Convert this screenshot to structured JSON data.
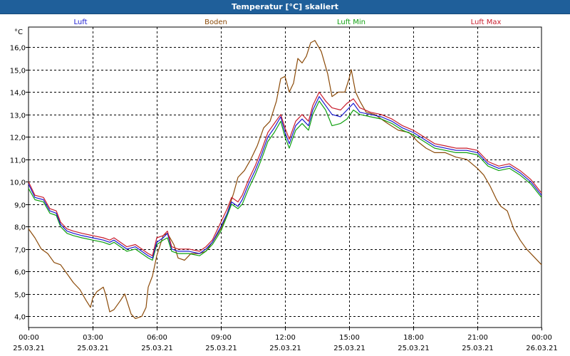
{
  "window": {
    "title": "Temperatur [°C] skaliert"
  },
  "chart_data": {
    "type": "line",
    "title": "Temperatur [°C] skaliert",
    "ylabel": "°C",
    "xlabel": "",
    "ylim": [
      3.5,
      16.9
    ],
    "yticks": [
      4.0,
      5.0,
      6.0,
      7.0,
      8.0,
      9.0,
      10.0,
      11.0,
      12.0,
      13.0,
      14.0,
      15.0,
      16.0
    ],
    "ytick_labels": [
      "4,0",
      "5,0",
      "6,0",
      "7,0",
      "8,0",
      "9,0",
      "10,0",
      "11,0",
      "12,0",
      "13,0",
      "14,0",
      "15,0",
      "16,0"
    ],
    "xlim_hours": [
      0,
      24
    ],
    "xticks": [
      {
        "hour": 0,
        "time": "00:00",
        "date": "25.03.21"
      },
      {
        "hour": 3,
        "time": "03:00",
        "date": "25.03.21"
      },
      {
        "hour": 6,
        "time": "06:00",
        "date": "25.03.21"
      },
      {
        "hour": 9,
        "time": "09:00",
        "date": "25.03.21"
      },
      {
        "hour": 12,
        "time": "12:00",
        "date": "25.03.21"
      },
      {
        "hour": 15,
        "time": "15:00",
        "date": "25.03.21"
      },
      {
        "hour": 18,
        "time": "18:00",
        "date": "25.03.21"
      },
      {
        "hour": 21,
        "time": "21:00",
        "date": "25.03.21"
      },
      {
        "hour": 24,
        "time": "00:00",
        "date": "26.03.21"
      }
    ],
    "grid": true,
    "legend_position": "top",
    "series": [
      {
        "name": "Luft",
        "color": "#1a1ad0",
        "points": [
          [
            0,
            9.9
          ],
          [
            0.3,
            9.3
          ],
          [
            0.7,
            9.2
          ],
          [
            1.0,
            8.7
          ],
          [
            1.3,
            8.6
          ],
          [
            1.5,
            8.1
          ],
          [
            1.8,
            7.8
          ],
          [
            2.1,
            7.7
          ],
          [
            2.5,
            7.6
          ],
          [
            3.0,
            7.5
          ],
          [
            3.5,
            7.4
          ],
          [
            3.8,
            7.3
          ],
          [
            4.0,
            7.4
          ],
          [
            4.3,
            7.2
          ],
          [
            4.6,
            7.0
          ],
          [
            5.0,
            7.1
          ],
          [
            5.3,
            6.9
          ],
          [
            5.6,
            6.7
          ],
          [
            5.8,
            6.6
          ],
          [
            6.0,
            7.3
          ],
          [
            6.3,
            7.5
          ],
          [
            6.5,
            7.7
          ],
          [
            6.7,
            7.0
          ],
          [
            7.0,
            6.9
          ],
          [
            7.5,
            6.9
          ],
          [
            8.0,
            6.8
          ],
          [
            8.3,
            7.0
          ],
          [
            8.6,
            7.3
          ],
          [
            9.0,
            8.0
          ],
          [
            9.3,
            8.6
          ],
          [
            9.5,
            9.1
          ],
          [
            9.8,
            8.9
          ],
          [
            10.0,
            9.2
          ],
          [
            10.3,
            9.9
          ],
          [
            10.6,
            10.5
          ],
          [
            10.9,
            11.2
          ],
          [
            11.2,
            12.0
          ],
          [
            11.5,
            12.4
          ],
          [
            11.8,
            12.9
          ],
          [
            12.0,
            12.2
          ],
          [
            12.2,
            11.7
          ],
          [
            12.5,
            12.5
          ],
          [
            12.8,
            12.8
          ],
          [
            13.1,
            12.5
          ],
          [
            13.3,
            13.2
          ],
          [
            13.6,
            13.8
          ],
          [
            13.9,
            13.4
          ],
          [
            14.2,
            13.0
          ],
          [
            14.6,
            12.9
          ],
          [
            14.9,
            13.2
          ],
          [
            15.2,
            13.5
          ],
          [
            15.5,
            13.1
          ],
          [
            16.0,
            13.0
          ],
          [
            16.5,
            12.9
          ],
          [
            17.0,
            12.7
          ],
          [
            17.5,
            12.4
          ],
          [
            18.0,
            12.2
          ],
          [
            18.5,
            11.9
          ],
          [
            19.0,
            11.6
          ],
          [
            19.5,
            11.5
          ],
          [
            20.0,
            11.4
          ],
          [
            20.5,
            11.4
          ],
          [
            21.0,
            11.3
          ],
          [
            21.5,
            10.8
          ],
          [
            22.0,
            10.6
          ],
          [
            22.5,
            10.7
          ],
          [
            23.0,
            10.4
          ],
          [
            23.5,
            10.0
          ],
          [
            24.0,
            9.4
          ]
        ]
      },
      {
        "name": "Boden",
        "color": "#8b4a08",
        "points": [
          [
            0,
            7.9
          ],
          [
            0.3,
            7.5
          ],
          [
            0.6,
            7.0
          ],
          [
            0.9,
            6.8
          ],
          [
            1.2,
            6.4
          ],
          [
            1.5,
            6.3
          ],
          [
            1.8,
            5.9
          ],
          [
            2.1,
            5.5
          ],
          [
            2.4,
            5.2
          ],
          [
            2.7,
            4.7
          ],
          [
            2.9,
            4.4
          ],
          [
            3.0,
            4.8
          ],
          [
            3.2,
            5.1
          ],
          [
            3.5,
            5.3
          ],
          [
            3.6,
            5.0
          ],
          [
            3.8,
            4.2
          ],
          [
            4.0,
            4.3
          ],
          [
            4.3,
            4.7
          ],
          [
            4.5,
            5.0
          ],
          [
            4.8,
            4.1
          ],
          [
            5.0,
            3.9
          ],
          [
            5.3,
            4.0
          ],
          [
            5.5,
            4.4
          ],
          [
            5.6,
            5.3
          ],
          [
            5.8,
            5.8
          ],
          [
            6.0,
            6.7
          ],
          [
            6.3,
            7.6
          ],
          [
            6.5,
            7.7
          ],
          [
            6.8,
            7.2
          ],
          [
            7.0,
            6.6
          ],
          [
            7.3,
            6.5
          ],
          [
            7.6,
            6.8
          ],
          [
            8.0,
            6.8
          ],
          [
            8.3,
            6.9
          ],
          [
            8.6,
            7.3
          ],
          [
            9.0,
            7.9
          ],
          [
            9.3,
            8.6
          ],
          [
            9.6,
            9.5
          ],
          [
            9.8,
            10.2
          ],
          [
            10.1,
            10.5
          ],
          [
            10.4,
            11.0
          ],
          [
            10.7,
            11.6
          ],
          [
            11.0,
            12.4
          ],
          [
            11.3,
            12.7
          ],
          [
            11.6,
            13.6
          ],
          [
            11.8,
            14.6
          ],
          [
            12.0,
            14.7
          ],
          [
            12.2,
            14.0
          ],
          [
            12.4,
            14.4
          ],
          [
            12.6,
            15.5
          ],
          [
            12.8,
            15.3
          ],
          [
            13.0,
            15.6
          ],
          [
            13.2,
            16.2
          ],
          [
            13.4,
            16.3
          ],
          [
            13.7,
            15.8
          ],
          [
            14.0,
            14.8
          ],
          [
            14.2,
            13.8
          ],
          [
            14.5,
            14.0
          ],
          [
            14.8,
            14.0
          ],
          [
            15.0,
            14.6
          ],
          [
            15.1,
            15.0
          ],
          [
            15.3,
            14.0
          ],
          [
            15.5,
            13.6
          ],
          [
            15.8,
            13.1
          ],
          [
            16.2,
            13.0
          ],
          [
            16.8,
            12.6
          ],
          [
            17.3,
            12.3
          ],
          [
            17.8,
            12.2
          ],
          [
            18.2,
            11.8
          ],
          [
            18.6,
            11.5
          ],
          [
            19.0,
            11.3
          ],
          [
            19.5,
            11.3
          ],
          [
            20.0,
            11.1
          ],
          [
            20.5,
            11.0
          ],
          [
            21.0,
            10.6
          ],
          [
            21.3,
            10.3
          ],
          [
            21.6,
            9.8
          ],
          [
            21.9,
            9.2
          ],
          [
            22.1,
            8.9
          ],
          [
            22.4,
            8.7
          ],
          [
            22.7,
            7.9
          ],
          [
            23.0,
            7.4
          ],
          [
            23.3,
            7.0
          ],
          [
            23.6,
            6.7
          ],
          [
            24.0,
            6.3
          ]
        ]
      },
      {
        "name": "Luft Min",
        "color": "#10a010",
        "points": [
          [
            0,
            9.7
          ],
          [
            0.3,
            9.2
          ],
          [
            0.7,
            9.1
          ],
          [
            1.0,
            8.6
          ],
          [
            1.3,
            8.5
          ],
          [
            1.5,
            8.0
          ],
          [
            1.8,
            7.7
          ],
          [
            2.1,
            7.6
          ],
          [
            2.5,
            7.5
          ],
          [
            3.0,
            7.4
          ],
          [
            3.5,
            7.3
          ],
          [
            3.8,
            7.2
          ],
          [
            4.0,
            7.3
          ],
          [
            4.3,
            7.1
          ],
          [
            4.6,
            6.9
          ],
          [
            5.0,
            7.0
          ],
          [
            5.3,
            6.8
          ],
          [
            5.6,
            6.6
          ],
          [
            5.8,
            6.5
          ],
          [
            6.0,
            7.2
          ],
          [
            6.3,
            7.4
          ],
          [
            6.5,
            7.5
          ],
          [
            6.7,
            6.9
          ],
          [
            7.0,
            6.8
          ],
          [
            7.5,
            6.8
          ],
          [
            8.0,
            6.7
          ],
          [
            8.3,
            6.9
          ],
          [
            8.6,
            7.2
          ],
          [
            9.0,
            7.8
          ],
          [
            9.3,
            8.5
          ],
          [
            9.5,
            9.0
          ],
          [
            9.8,
            8.8
          ],
          [
            10.0,
            9.0
          ],
          [
            10.3,
            9.7
          ],
          [
            10.6,
            10.3
          ],
          [
            10.9,
            11.0
          ],
          [
            11.2,
            11.8
          ],
          [
            11.5,
            12.2
          ],
          [
            11.8,
            12.7
          ],
          [
            12.0,
            12.0
          ],
          [
            12.2,
            11.5
          ],
          [
            12.5,
            12.3
          ],
          [
            12.8,
            12.6
          ],
          [
            13.1,
            12.3
          ],
          [
            13.3,
            13.0
          ],
          [
            13.6,
            13.6
          ],
          [
            13.9,
            13.2
          ],
          [
            14.2,
            12.5
          ],
          [
            14.6,
            12.6
          ],
          [
            14.9,
            12.8
          ],
          [
            15.2,
            13.2
          ],
          [
            15.5,
            13.0
          ],
          [
            16.0,
            12.9
          ],
          [
            16.5,
            12.8
          ],
          [
            17.0,
            12.6
          ],
          [
            17.5,
            12.3
          ],
          [
            18.0,
            12.1
          ],
          [
            18.5,
            11.8
          ],
          [
            19.0,
            11.5
          ],
          [
            19.5,
            11.4
          ],
          [
            20.0,
            11.3
          ],
          [
            20.5,
            11.3
          ],
          [
            21.0,
            11.2
          ],
          [
            21.5,
            10.7
          ],
          [
            22.0,
            10.5
          ],
          [
            22.5,
            10.6
          ],
          [
            23.0,
            10.3
          ],
          [
            23.5,
            9.9
          ],
          [
            24.0,
            9.3
          ]
        ]
      },
      {
        "name": "Luft Max",
        "color": "#c81c2c",
        "points": [
          [
            0,
            10.0
          ],
          [
            0.3,
            9.4
          ],
          [
            0.7,
            9.3
          ],
          [
            1.0,
            8.8
          ],
          [
            1.3,
            8.7
          ],
          [
            1.5,
            8.2
          ],
          [
            1.8,
            7.9
          ],
          [
            2.1,
            7.8
          ],
          [
            2.5,
            7.7
          ],
          [
            3.0,
            7.6
          ],
          [
            3.5,
            7.5
          ],
          [
            3.8,
            7.4
          ],
          [
            4.0,
            7.5
          ],
          [
            4.3,
            7.3
          ],
          [
            4.6,
            7.1
          ],
          [
            5.0,
            7.2
          ],
          [
            5.3,
            7.0
          ],
          [
            5.6,
            6.8
          ],
          [
            5.8,
            6.7
          ],
          [
            6.0,
            7.5
          ],
          [
            6.3,
            7.6
          ],
          [
            6.5,
            7.8
          ],
          [
            6.7,
            7.1
          ],
          [
            7.0,
            7.0
          ],
          [
            7.5,
            7.0
          ],
          [
            8.0,
            6.9
          ],
          [
            8.3,
            7.1
          ],
          [
            8.6,
            7.4
          ],
          [
            9.0,
            8.2
          ],
          [
            9.3,
            8.8
          ],
          [
            9.5,
            9.3
          ],
          [
            9.8,
            9.1
          ],
          [
            10.0,
            9.4
          ],
          [
            10.3,
            10.1
          ],
          [
            10.6,
            10.7
          ],
          [
            10.9,
            11.4
          ],
          [
            11.2,
            12.2
          ],
          [
            11.5,
            12.6
          ],
          [
            11.8,
            13.0
          ],
          [
            12.0,
            12.4
          ],
          [
            12.2,
            11.9
          ],
          [
            12.5,
            12.7
          ],
          [
            12.8,
            13.0
          ],
          [
            13.1,
            12.7
          ],
          [
            13.3,
            13.4
          ],
          [
            13.6,
            14.0
          ],
          [
            13.9,
            13.6
          ],
          [
            14.2,
            13.3
          ],
          [
            14.6,
            13.2
          ],
          [
            14.9,
            13.5
          ],
          [
            15.2,
            13.7
          ],
          [
            15.5,
            13.3
          ],
          [
            16.0,
            13.1
          ],
          [
            16.5,
            13.0
          ],
          [
            17.0,
            12.8
          ],
          [
            17.5,
            12.5
          ],
          [
            18.0,
            12.3
          ],
          [
            18.5,
            12.0
          ],
          [
            19.0,
            11.7
          ],
          [
            19.5,
            11.6
          ],
          [
            20.0,
            11.5
          ],
          [
            20.5,
            11.5
          ],
          [
            21.0,
            11.4
          ],
          [
            21.5,
            10.9
          ],
          [
            22.0,
            10.7
          ],
          [
            22.5,
            10.8
          ],
          [
            23.0,
            10.5
          ],
          [
            23.5,
            10.1
          ],
          [
            24.0,
            9.5
          ]
        ]
      }
    ]
  }
}
